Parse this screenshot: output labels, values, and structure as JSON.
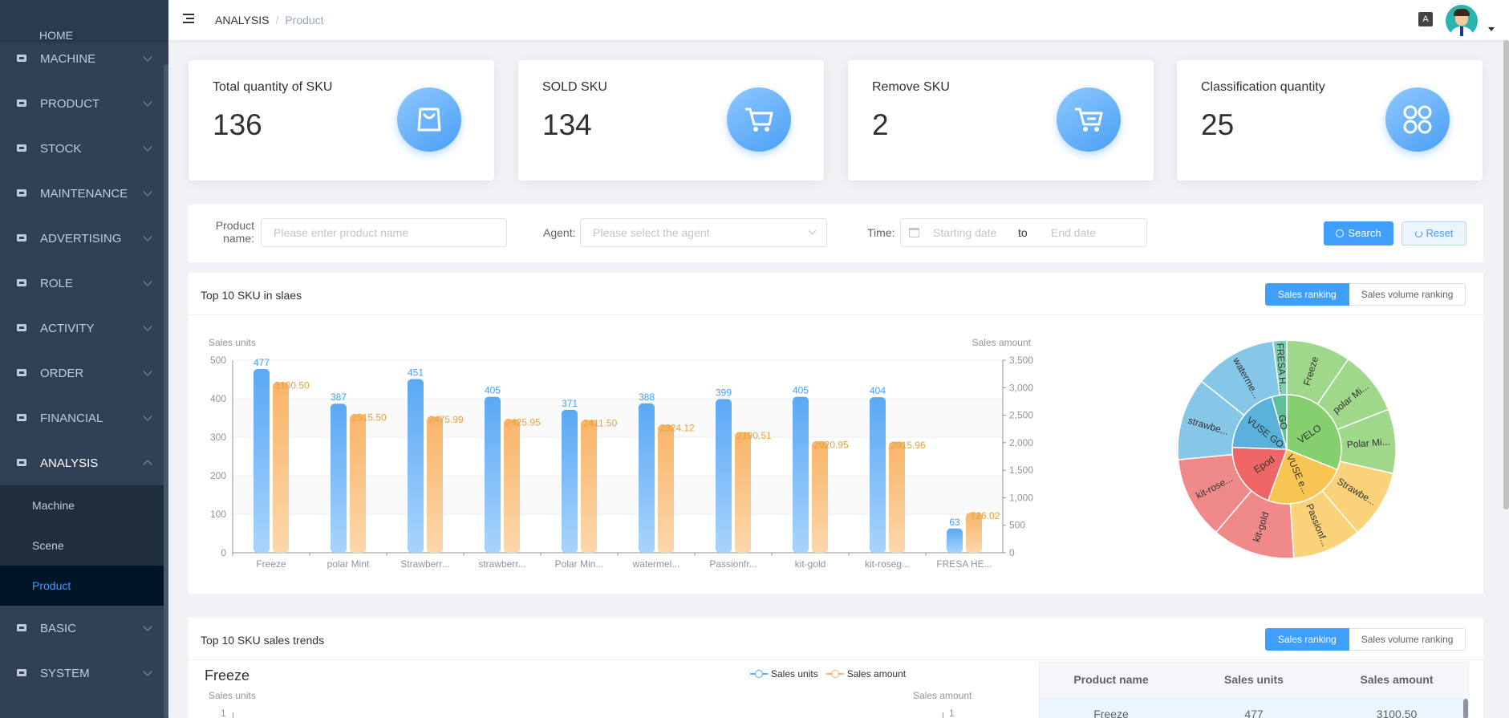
{
  "sidebar": {
    "top_partial": "HOME",
    "items": [
      {
        "label": "MACHINE",
        "icon": "monitor-icon"
      },
      {
        "label": "PRODUCT",
        "icon": "product-icon"
      },
      {
        "label": "STOCK",
        "icon": "stock-icon"
      },
      {
        "label": "MAINTENANCE",
        "icon": "maintenance-icon"
      },
      {
        "label": "ADVERTISING",
        "icon": "send-icon"
      },
      {
        "label": "ROLE",
        "icon": "role-icon"
      },
      {
        "label": "ACTIVITY",
        "icon": "activity-icon"
      },
      {
        "label": "ORDER",
        "icon": "order-icon"
      },
      {
        "label": "FINANCIAL",
        "icon": "financial-icon"
      },
      {
        "label": "ANALYSIS",
        "icon": "pie-icon"
      }
    ],
    "analysis_sub": [
      "Machine",
      "Scene",
      "Product"
    ],
    "bottom_items": [
      {
        "label": "BASIC",
        "icon": "basic-icon"
      },
      {
        "label": "SYSTEM",
        "icon": "gear-icon"
      }
    ]
  },
  "header": {
    "breadcrumb_root": "ANALYSIS",
    "breadcrumb_sep": "/",
    "breadcrumb_current": "Product",
    "lang_icon_text": "A"
  },
  "cards": [
    {
      "title": "Total quantity of SKU",
      "value": "136",
      "icon": "bag-icon"
    },
    {
      "title": "SOLD SKU",
      "value": "134",
      "icon": "cart-icon"
    },
    {
      "title": "Remove SKU",
      "value": "2",
      "icon": "cart-remove-icon"
    },
    {
      "title": "Classification quantity",
      "value": "25",
      "icon": "grid-icon"
    }
  ],
  "filter": {
    "product_label_1": "Product",
    "product_label_2": "name:",
    "product_placeholder": "Please enter product name",
    "agent_label": "Agent:",
    "agent_placeholder": "Please select the agent",
    "time_label": "Time:",
    "start_placeholder": "Starting date",
    "to": "to",
    "end_placeholder": "End date",
    "search_label": "Search",
    "reset_label": "Reset"
  },
  "panel1": {
    "title": "Top 10 SKU in slaes",
    "toggle_on": "Sales ranking",
    "toggle_off": "Sales volume ranking"
  },
  "panel2": {
    "title": "Top 10 SKU sales trends",
    "toggle_on": "Sales ranking",
    "toggle_off": "Sales volume ranking",
    "chart_title": "Freeze",
    "legend_units": "Sales units",
    "legend_amount": "Sales amount",
    "y_left_label": "Sales units",
    "y_right_label": "Sales amount",
    "y_left_top_tick": "1",
    "y_right_top_tick": "1",
    "table_headers": [
      "Product name",
      "Sales units",
      "Sales amount"
    ],
    "table_row": [
      "Freeze",
      "477",
      "3100.50"
    ]
  },
  "chart_data": [
    {
      "type": "bar",
      "ylabel": "Sales units",
      "y2label": "Sales amount",
      "ylim": [
        0,
        500
      ],
      "y2lim": [
        0,
        3500
      ],
      "yticks": [
        "0",
        "100",
        "200",
        "300",
        "400",
        "500"
      ],
      "y2ticks": [
        "0",
        "500",
        "1,000",
        "1,500",
        "2,000",
        "2,500",
        "3,000",
        "3,500"
      ],
      "categories": [
        "Freeze",
        "polar Mint",
        "Strawberr...",
        "strawberr...",
        "Polar Min...",
        "watermel...",
        "Passionfr...",
        "kit-gold",
        "kit-roseg...",
        "FRESA HE..."
      ],
      "series": [
        {
          "name": "Sales units",
          "axis": "left",
          "color": "#5aaef7",
          "values": [
            477,
            387,
            451,
            405,
            371,
            388,
            399,
            405,
            404,
            63
          ]
        },
        {
          "name": "Sales amount",
          "axis": "right",
          "color": "#f7b264",
          "values": [
            3100.5,
            2515.5,
            2475.99,
            2425.95,
            2411.5,
            2324.12,
            2190.51,
            2020.95,
            2015.96,
            726.02
          ],
          "labels": [
            "3100.50",
            "2515.50",
            "2475.99",
            "2425.95",
            "2411.50",
            "2324.12",
            "2190.51",
            "2020.95",
            "2015.96",
            "726.02"
          ]
        }
      ]
    },
    {
      "type": "pie",
      "inner": [
        {
          "label": "VELO",
          "color": "#85cf6e",
          "value": 28
        },
        {
          "label": "VUSE e...",
          "color": "#f8c553",
          "value": 22
        },
        {
          "label": "Epod",
          "color": "#ee6666",
          "value": 18
        },
        {
          "label": "VUSE GO",
          "color": "#5ab1dc",
          "value": 18
        },
        {
          "label": "GO",
          "color": "#5fbf9a",
          "value": 4
        }
      ],
      "outer": [
        {
          "label": "Freeze",
          "color": "#9fd88a",
          "value": 7
        },
        {
          "label": "polar Mi...",
          "color": "#9fd88a",
          "value": 7
        },
        {
          "label": "Polar Mi...",
          "color": "#9fd88a",
          "value": 7
        },
        {
          "label": "Strawbe...",
          "color": "#f9d27a",
          "value": 7.5
        },
        {
          "label": "Passionf...",
          "color": "#f9d27a",
          "value": 7.5
        },
        {
          "label": "kit-gold",
          "color": "#f08a8a",
          "value": 9
        },
        {
          "label": "kit-rose...",
          "color": "#f08a8a",
          "value": 9
        },
        {
          "label": "strawbe...",
          "color": "#86c6e6",
          "value": 9
        },
        {
          "label": "waterme...",
          "color": "#86c6e6",
          "value": 9
        },
        {
          "label": "FRESA H...",
          "color": "#7ecfb0",
          "value": 1.5
        }
      ]
    }
  ]
}
